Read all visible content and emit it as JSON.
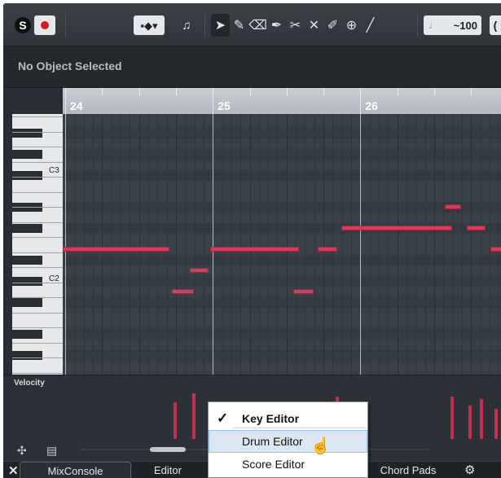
{
  "toolbar": {
    "solo_label": "S",
    "velocity_value": "~100",
    "edge_label": "",
    "tools": [
      {
        "name": "object-selection",
        "glyph": "➤"
      },
      {
        "name": "draw",
        "glyph": "✎"
      },
      {
        "name": "erase",
        "glyph": "⌫"
      },
      {
        "name": "pen",
        "glyph": "✒"
      },
      {
        "name": "trim",
        "glyph": "✂"
      },
      {
        "name": "mute",
        "glyph": "✕"
      },
      {
        "name": "glue",
        "glyph": "✐"
      },
      {
        "name": "zoom",
        "glyph": "⊕"
      },
      {
        "name": "line",
        "glyph": "╱"
      }
    ]
  },
  "info_line": {
    "text": "No Object Selected"
  },
  "ruler": {
    "bars": [
      "24",
      "25",
      "26"
    ]
  },
  "keyboard": {
    "labels": [
      "C3",
      "C2"
    ]
  },
  "velocity": {
    "label": "Velocity"
  },
  "context_menu": {
    "items": [
      {
        "label": "Key Editor",
        "checked": true,
        "bold": true
      },
      {
        "label": "Drum Editor",
        "checked": false,
        "hover": true
      },
      {
        "label": "Score Editor",
        "checked": false
      }
    ]
  },
  "tabs": {
    "mixconsole": "MixConsole",
    "editor": "Editor",
    "chord_pads": "Chord Pads"
  },
  "colors": {
    "note": "#d43c5a",
    "velocity": "#c43050",
    "background": "#2a2e34"
  },
  "notes": [
    {
      "pitch_row": 12,
      "start_beat": 0.0,
      "length_beats": 2.9
    },
    {
      "pitch_row": 14,
      "start_beat": 3.45,
      "length_beats": 0.5
    },
    {
      "pitch_row": 16,
      "start_beat": 2.95,
      "length_beats": 0.6
    },
    {
      "pitch_row": 12,
      "start_beat": 4.0,
      "length_beats": 2.4
    },
    {
      "pitch_row": 16,
      "start_beat": 6.25,
      "length_beats": 0.55
    },
    {
      "pitch_row": 12,
      "start_beat": 6.9,
      "length_beats": 0.55
    },
    {
      "pitch_row": 10,
      "start_beat": 7.55,
      "length_beats": 3.0
    },
    {
      "pitch_row": 8,
      "start_beat": 10.35,
      "length_beats": 0.45
    },
    {
      "pitch_row": 10,
      "start_beat": 10.95,
      "length_beats": 0.5
    },
    {
      "pitch_row": 12,
      "start_beat": 11.6,
      "length_beats": 0.4
    }
  ],
  "velocities": [
    {
      "beat": 3.0,
      "value": 60
    },
    {
      "beat": 3.5,
      "value": 75
    },
    {
      "beat": 6.6,
      "value": 60
    },
    {
      "beat": 7.05,
      "value": 60
    },
    {
      "beat": 7.4,
      "value": 70
    },
    {
      "beat": 10.5,
      "value": 70
    },
    {
      "beat": 11.0,
      "value": 55
    },
    {
      "beat": 11.3,
      "value": 65
    },
    {
      "beat": 11.7,
      "value": 50
    }
  ]
}
